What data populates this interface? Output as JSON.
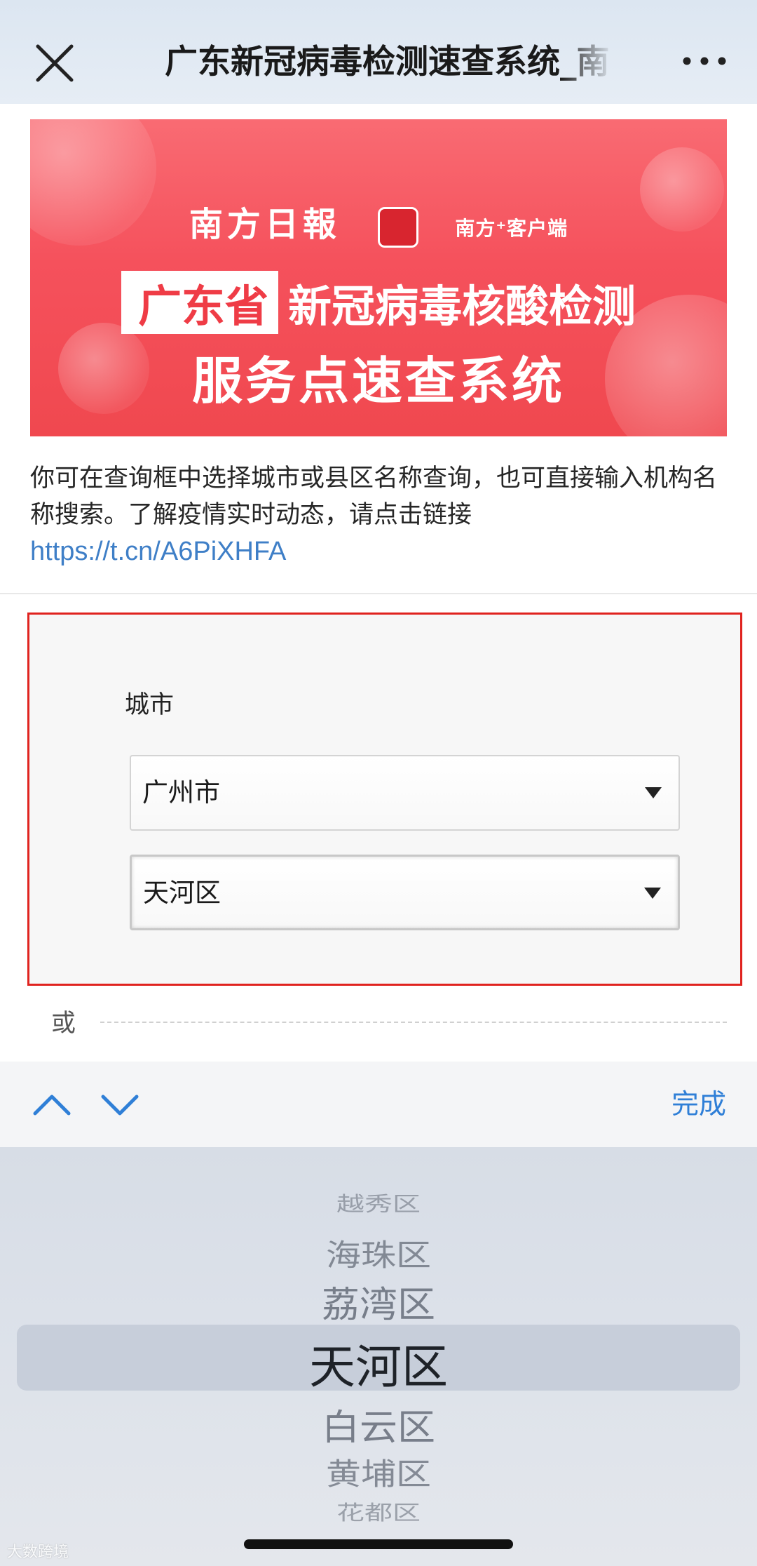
{
  "navbar": {
    "title": "广东新冠病毒检测速查系统_南",
    "close_icon": "close-icon",
    "more_icon": "more-icon"
  },
  "banner": {
    "brand": "南方日報",
    "app_name": "南方⁺客户端",
    "province": "广东省",
    "line1_rest": "新冠病毒核酸检测",
    "line2": "服务点速查系统",
    "colors": {
      "background": "#f5515c",
      "text": "#ffffff"
    }
  },
  "intro": {
    "text": "你可在查询框中选择城市或县区名称查询，也可直接输入机构名称搜索。了解疫情实时动态，请点击链接",
    "link": "https://t.cn/A6PiXHFA"
  },
  "search": {
    "city_label": "城市",
    "city_value": "广州市",
    "district_value": "天河区",
    "or_label": "或",
    "border_color": "#e0231f"
  },
  "accessory": {
    "up_icon": "chevron-up-icon",
    "down_icon": "chevron-down-icon",
    "done_label": "完成",
    "accent": "#2f7fd7"
  },
  "picker": {
    "items": [
      "越秀区",
      "海珠区",
      "荔湾区",
      "天河区",
      "白云区",
      "黄埔区",
      "花都区"
    ],
    "selected": "天河区"
  },
  "watermark": "大数跨境"
}
